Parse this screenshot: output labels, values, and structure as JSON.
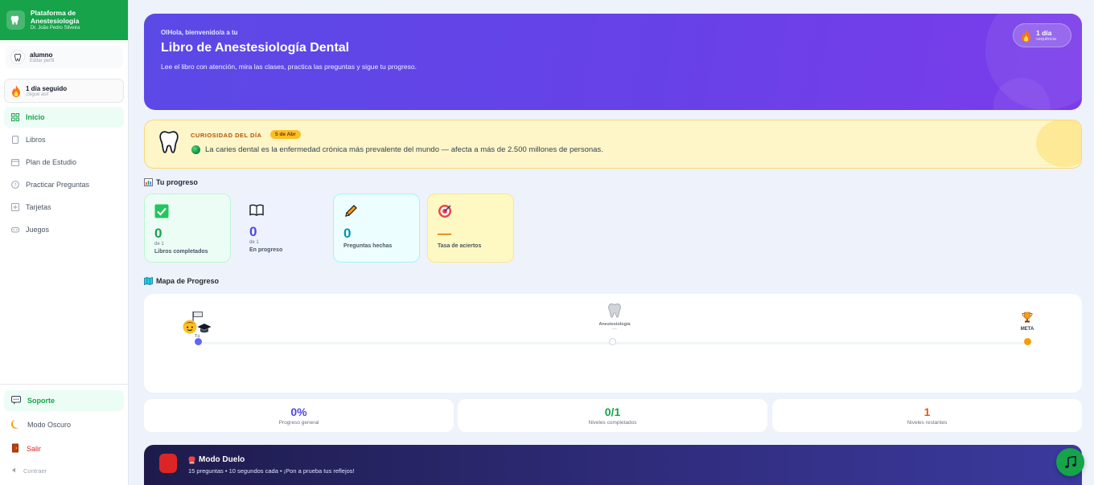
{
  "sidebar": {
    "brand_title": "Plataforma de Anestesiología",
    "brand_subtitle": "Dr. João Pedro Silveira",
    "profile_name": "alumno",
    "profile_action": "Editar perfil",
    "streak_title": "1 día seguido",
    "streak_subtitle": "¡Sigue así!",
    "nav": [
      {
        "label": "Inicio",
        "icon": "grid-icon",
        "active": true
      },
      {
        "label": "Libros",
        "icon": "book-icon"
      },
      {
        "label": "Plan de Estudio",
        "icon": "calendar-icon"
      },
      {
        "label": "Practicar Preguntas",
        "icon": "help-circle-icon"
      },
      {
        "label": "Tarjetas",
        "icon": "cards-icon"
      },
      {
        "label": "Juegos",
        "icon": "gamepad-icon"
      }
    ],
    "support_label": "Soporte",
    "dark_mode_label": "Modo Oscuro",
    "logout_label": "Salir",
    "collapse_label": "Contraer"
  },
  "hero": {
    "kicker": "OlHola, bienvenido/a a tu",
    "title": "Libro de Anestesiología Dental",
    "description": "Lee el libro con atención, mira las clases, practica las preguntas y sigue tu progreso.",
    "badge_title": "1 día",
    "badge_subtitle": "sequência"
  },
  "curiosity": {
    "label": "CURIOSIDAD DEL DÍA",
    "date": "5 de Abr",
    "text": "La caries dental es la enfermedad crónica más prevalente del mundo — afecta a más de 2.500 millones de personas."
  },
  "progress": {
    "section_title": "Tu progreso",
    "cards": [
      {
        "value": "0",
        "sub": "de 1",
        "label": "Libros completados",
        "color": "#16a34a",
        "bg": "#ecfdf5",
        "border": "#bbf7d0",
        "icon": "check-icon"
      },
      {
        "value": "0",
        "sub": "de 1",
        "label": "En progreso",
        "color": "#4f46e5",
        "bg": "#eef2ff",
        "border": "#eef2ff",
        "icon": "open-book-icon"
      },
      {
        "value": "0",
        "sub": "",
        "label": "Preguntas hechas",
        "color": "#0891b2",
        "bg": "#ecfeff",
        "border": "#a5f3fc",
        "icon": "pencil-icon"
      },
      {
        "value": "—",
        "sub": "",
        "label": "Tasa de aciertos",
        "color": "#d97706",
        "bg": "#fef9c3",
        "border": "#fde68a",
        "icon": "target-icon"
      }
    ]
  },
  "map": {
    "section_title": "Mapa de Progreso",
    "you_label": "Tú",
    "level_label": "Anestesiología",
    "level_sub": "—",
    "goal_label": "META"
  },
  "summary": [
    {
      "value": "0%",
      "label": "Progreso general",
      "color": "#4f46e5"
    },
    {
      "value": "0/1",
      "label": "Niveles completados",
      "color": "#16a34a"
    },
    {
      "value": "1",
      "label": "Niveles restantes",
      "color": "#ea580c"
    }
  ],
  "duel": {
    "title": "Modo Duelo",
    "subtitle": "15 preguntas • 10 segundos cada • ¡Pon a prueba tus reflejos!"
  }
}
